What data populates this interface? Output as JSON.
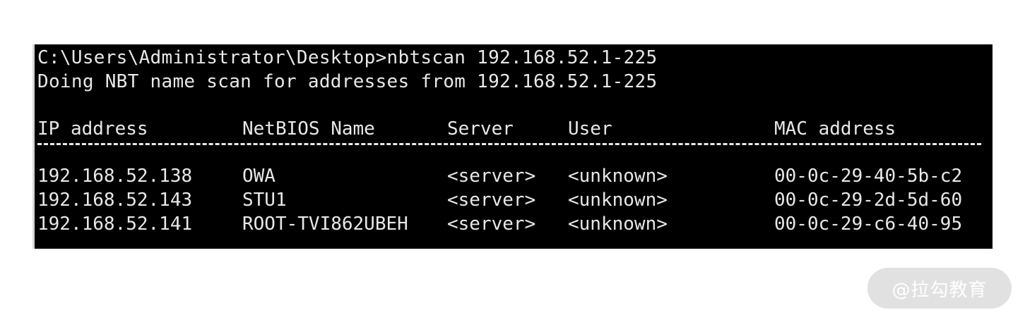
{
  "terminal": {
    "command_line": "C:\\Users\\Administrator\\Desktop>nbtscan 192.168.52.1-225",
    "status_line": "Doing NBT name scan for addresses from 192.168.52.1-225",
    "columns": {
      "ip": "IP address",
      "netbios": "NetBIOS Name",
      "server": "Server",
      "user": "User",
      "mac": "MAC address"
    },
    "rows": [
      {
        "ip": "192.168.52.138",
        "netbios": "OWA",
        "server": "<server>",
        "user": "<unknown>",
        "mac": "00-0c-29-40-5b-c2"
      },
      {
        "ip": "192.168.52.143",
        "netbios": "STU1",
        "server": "<server>",
        "user": "<unknown>",
        "mac": "00-0c-29-2d-5d-60"
      },
      {
        "ip": "192.168.52.141",
        "netbios": "ROOT-TVI862UBEH",
        "server": "<server>",
        "user": "<unknown>",
        "mac": "00-0c-29-c6-40-95"
      }
    ]
  },
  "watermark": {
    "text": "@拉勾教育"
  },
  "colors": {
    "terminal_bg": "#000000",
    "terminal_text": "#e8e8e8",
    "watermark_bg": "#e1e1e1"
  }
}
